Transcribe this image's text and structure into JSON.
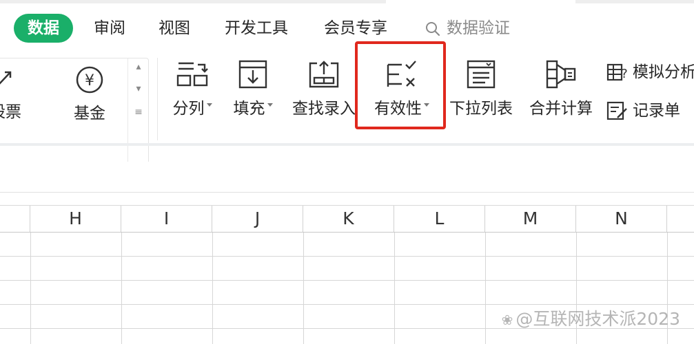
{
  "tabs": {
    "items": [
      "数据",
      "审阅",
      "视图",
      "开发工具",
      "会员专享"
    ],
    "search_label": "数据验证"
  },
  "ribbon": {
    "gallery": {
      "items": [
        "股票",
        "基金"
      ]
    },
    "buttons": {
      "split": "分列",
      "fill": "填充",
      "lookup": "查找录入",
      "validity": "有效性",
      "dropdown": "下拉列表",
      "consolidate": "合并计算",
      "whatif": "模拟分析",
      "record": "记录单"
    }
  },
  "grid": {
    "columns": [
      "H",
      "I",
      "J",
      "K",
      "L",
      "M",
      "N"
    ]
  },
  "watermark": "@互联网技术派2023",
  "colors": {
    "accent": "#1aaf69",
    "highlight": "#e0281d"
  }
}
